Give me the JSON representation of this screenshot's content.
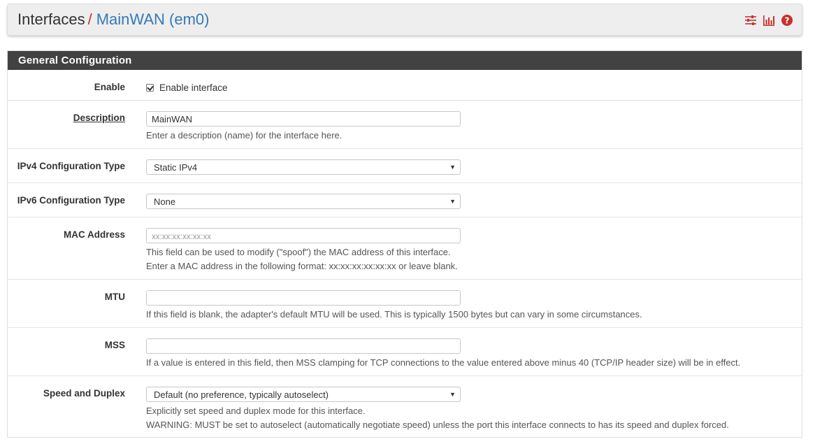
{
  "breadcrumb": {
    "root": "Interfaces",
    "separator": "/",
    "current": "MainWAN (em0)"
  },
  "header_icons": [
    "sliders-icon",
    "bar-chart-icon",
    "help-icon"
  ],
  "accent_color": "#c9302c",
  "link_color": "#337ab7",
  "panel": {
    "title": "General Configuration",
    "rows": {
      "enable": {
        "label": "Enable",
        "checkbox_label": "Enable interface",
        "checked": true
      },
      "description": {
        "label": "Description",
        "value": "MainWAN",
        "help": "Enter a description (name) for the interface here."
      },
      "ipv4": {
        "label": "IPv4 Configuration Type",
        "selected": "Static IPv4"
      },
      "ipv6": {
        "label": "IPv6 Configuration Type",
        "selected": "None"
      },
      "mac": {
        "label": "MAC Address",
        "placeholder": "xx:xx:xx:xx:xx:xx",
        "value": "",
        "help1": "This field can be used to modify (\"spoof\") the MAC address of this interface.",
        "help2": "Enter a MAC address in the following format: xx:xx:xx:xx:xx:xx or leave blank."
      },
      "mtu": {
        "label": "MTU",
        "value": "",
        "help": "If this field is blank, the adapter's default MTU will be used. This is typically 1500 bytes but can vary in some circumstances."
      },
      "mss": {
        "label": "MSS",
        "value": "",
        "help": "If a value is entered in this field, then MSS clamping for TCP connections to the value entered above minus 40 (TCP/IP header size) will be in effect."
      },
      "speed": {
        "label": "Speed and Duplex",
        "selected": "Default (no preference, typically autoselect)",
        "help1": "Explicitly set speed and duplex mode for this interface.",
        "help2": "WARNING: MUST be set to autoselect (automatically negotiate speed) unless the port this interface connects to has its speed and duplex forced."
      }
    }
  }
}
